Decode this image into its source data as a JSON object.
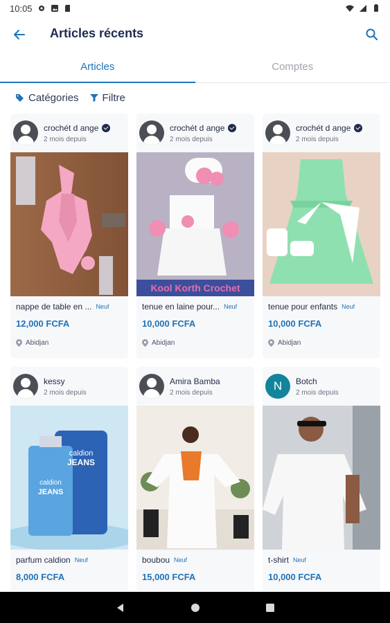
{
  "status_bar": {
    "time": "10:05"
  },
  "app_bar": {
    "title": "Articles récents"
  },
  "tabs": [
    {
      "label": "Articles",
      "active": true
    },
    {
      "label": "Comptes",
      "active": false
    }
  ],
  "filters": {
    "categories_label": "Catégories",
    "filter_label": "Filtre"
  },
  "products": [
    {
      "seller": "crochét d ange",
      "verified": true,
      "posted": "2 mois depuis",
      "title": "nappe de table en ...",
      "condition": "Neuf",
      "price": "12,000 FCFA",
      "location": "Abidjan",
      "avatar": "default-avatar-icon"
    },
    {
      "seller": "crochét d ange",
      "verified": true,
      "posted": "2 mois depuis",
      "title": "tenue en laine pour...",
      "condition": "Neuf",
      "price": "10,000 FCFA",
      "location": "Abidjan",
      "avatar": "default-avatar-icon"
    },
    {
      "seller": "crochét d ange",
      "verified": true,
      "posted": "2 mois depuis",
      "title": "tenue pour enfants",
      "condition": "Neuf",
      "price": "10,000 FCFA",
      "location": "Abidjan",
      "avatar": "default-avatar-icon"
    },
    {
      "seller": "kessy",
      "verified": false,
      "posted": "2 mois depuis",
      "title": "parfum caldion",
      "condition": "Neuf",
      "price": "8,000 FCFA",
      "avatar": "default-avatar-icon"
    },
    {
      "seller": "Amira Bamba",
      "verified": false,
      "posted": "2 mois depuis",
      "title": "boubou",
      "condition": "Neuf",
      "price": "15,000 FCFA",
      "avatar": "default-avatar-icon"
    },
    {
      "seller": "Botch",
      "verified": false,
      "posted": "2 mois depuis",
      "title": "t-shirt",
      "condition": "Neuf",
      "price": "10,000 FCFA",
      "avatar_letter": "N"
    }
  ],
  "photo_text": {
    "crochet_banner": "Kool Korth Crochet",
    "perfume_brand": "caldion",
    "perfume_line": "JEANS"
  },
  "colors": {
    "accent": "#1f73b7",
    "title": "#1d2b4f",
    "card_bg": "#f7f8fa",
    "avatar_letter_bg": "#12849c"
  }
}
